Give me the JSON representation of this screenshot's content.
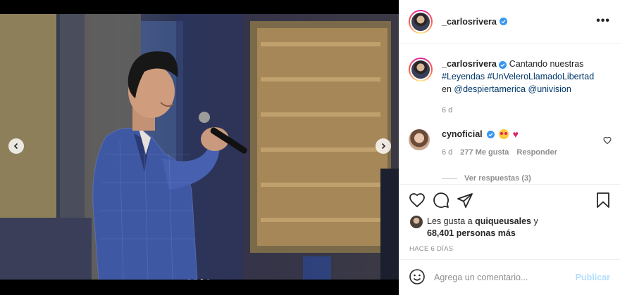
{
  "post": {
    "username": "_carlosrivera",
    "caption_text": " Cantando nuestras ",
    "hashtags": [
      "#Leyendas",
      "#UnVeleroLlamadoLibertad"
    ],
    "caption_in": "en ",
    "mentions": [
      "@despiertamerica",
      "@univision"
    ],
    "time_small": "6 d",
    "media": {
      "slides": 4,
      "active_slide": 3
    }
  },
  "reply": {
    "username": "cynoficial",
    "time": "6 d",
    "likes": "277 Me gusta",
    "reply_label": "Responder",
    "view_replies": "Ver respuestas (3)"
  },
  "likes": {
    "prefix": "Les gusta a ",
    "user": "quiqueusales",
    "joiner": " y",
    "others": "68,401 personas más"
  },
  "ago": "HACE 6 DÍAS",
  "compose": {
    "placeholder": "Agrega un comentario...",
    "post_label": "Publicar"
  },
  "icons": {
    "more": "more-options-icon",
    "like": "heart-icon",
    "comment": "comment-icon",
    "share": "paper-plane-icon",
    "save": "bookmark-icon",
    "emoji": "emoji-icon",
    "verified": "verified-badge-icon"
  },
  "colors": {
    "link": "#00376b",
    "verified": "#3897f0",
    "muted": "#8e8e8e",
    "post_disabled": "#b2dffc"
  }
}
